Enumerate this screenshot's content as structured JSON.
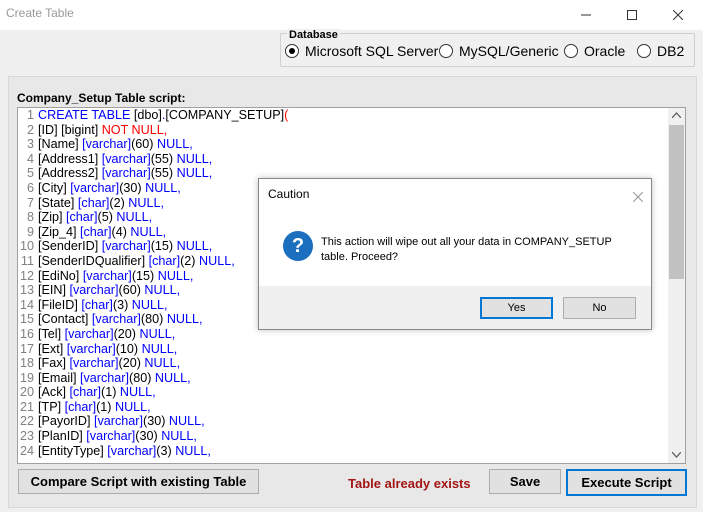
{
  "window": {
    "title": "Create Table"
  },
  "database": {
    "legend": "Database",
    "options": [
      "Microsoft SQL Server",
      "MySQL/Generic",
      "Oracle",
      "DB2"
    ],
    "selected": "Microsoft SQL Server"
  },
  "script": {
    "label": "Company_Setup Table script:",
    "lines": [
      [
        [
          "kw",
          "CREATE TABLE "
        ],
        [
          "tx",
          "[dbo]"
        ],
        [
          "kw",
          "."
        ],
        [
          "tx",
          "[COMPANY_SETUP]"
        ],
        [
          "id",
          "("
        ]
      ],
      [
        [
          "tx",
          "[ID] "
        ],
        [
          "tx",
          "[bigint] "
        ],
        [
          "id",
          "NOT NULL,"
        ]
      ],
      [
        [
          "tx",
          "[Name] "
        ],
        [
          "kw",
          "[varchar]"
        ],
        [
          "tx",
          "(60) "
        ],
        [
          "kw",
          "NULL,"
        ]
      ],
      [
        [
          "tx",
          "[Address1] "
        ],
        [
          "kw",
          "[varchar]"
        ],
        [
          "tx",
          "(55) "
        ],
        [
          "kw",
          "NULL,"
        ]
      ],
      [
        [
          "tx",
          "[Address2] "
        ],
        [
          "kw",
          "[varchar]"
        ],
        [
          "tx",
          "(55) "
        ],
        [
          "kw",
          "NULL,"
        ]
      ],
      [
        [
          "tx",
          "[City] "
        ],
        [
          "kw",
          "[varchar]"
        ],
        [
          "tx",
          "(30) "
        ],
        [
          "kw",
          "NULL,"
        ]
      ],
      [
        [
          "tx",
          "[State] "
        ],
        [
          "kw",
          "[char]"
        ],
        [
          "tx",
          "(2) "
        ],
        [
          "kw",
          "NULL,"
        ]
      ],
      [
        [
          "tx",
          "[Zip] "
        ],
        [
          "kw",
          "[char]"
        ],
        [
          "tx",
          "(5) "
        ],
        [
          "kw",
          "NULL,"
        ]
      ],
      [
        [
          "tx",
          "[Zip_4] "
        ],
        [
          "kw",
          "[char]"
        ],
        [
          "tx",
          "(4) "
        ],
        [
          "kw",
          "NULL,"
        ]
      ],
      [
        [
          "tx",
          "[SenderID] "
        ],
        [
          "kw",
          "[varchar]"
        ],
        [
          "tx",
          "(15) "
        ],
        [
          "kw",
          "NULL,"
        ]
      ],
      [
        [
          "tx",
          "[SenderIDQualifier] "
        ],
        [
          "kw",
          "[char]"
        ],
        [
          "tx",
          "(2) "
        ],
        [
          "kw",
          "NULL,"
        ]
      ],
      [
        [
          "tx",
          "[EdiNo] "
        ],
        [
          "kw",
          "[varchar]"
        ],
        [
          "tx",
          "(15) "
        ],
        [
          "kw",
          "NULL,"
        ]
      ],
      [
        [
          "tx",
          "[EIN] "
        ],
        [
          "kw",
          "[varchar]"
        ],
        [
          "tx",
          "(60) "
        ],
        [
          "kw",
          "NULL,"
        ]
      ],
      [
        [
          "tx",
          "[FileID] "
        ],
        [
          "kw",
          "[char]"
        ],
        [
          "tx",
          "(3) "
        ],
        [
          "kw",
          "NULL,"
        ]
      ],
      [
        [
          "tx",
          "[Contact] "
        ],
        [
          "kw",
          "[varchar]"
        ],
        [
          "tx",
          "(80) "
        ],
        [
          "kw",
          "NULL,"
        ]
      ],
      [
        [
          "tx",
          "[Tel] "
        ],
        [
          "kw",
          "[varchar]"
        ],
        [
          "tx",
          "(20) "
        ],
        [
          "kw",
          "NULL,"
        ]
      ],
      [
        [
          "tx",
          "[Ext] "
        ],
        [
          "kw",
          "[varchar]"
        ],
        [
          "tx",
          "(10) "
        ],
        [
          "kw",
          "NULL,"
        ]
      ],
      [
        [
          "tx",
          "[Fax] "
        ],
        [
          "kw",
          "[varchar]"
        ],
        [
          "tx",
          "(20) "
        ],
        [
          "kw",
          "NULL,"
        ]
      ],
      [
        [
          "tx",
          "[Email] "
        ],
        [
          "kw",
          "[varchar]"
        ],
        [
          "tx",
          "(80) "
        ],
        [
          "kw",
          "NULL,"
        ]
      ],
      [
        [
          "tx",
          "[Ack] "
        ],
        [
          "kw",
          "[char]"
        ],
        [
          "tx",
          "(1) "
        ],
        [
          "kw",
          "NULL,"
        ]
      ],
      [
        [
          "tx",
          "[TP] "
        ],
        [
          "kw",
          "[char]"
        ],
        [
          "tx",
          "(1) "
        ],
        [
          "kw",
          "NULL,"
        ]
      ],
      [
        [
          "tx",
          "[PayorID] "
        ],
        [
          "kw",
          "[varchar]"
        ],
        [
          "tx",
          "(30) "
        ],
        [
          "kw",
          "NULL,"
        ]
      ],
      [
        [
          "tx",
          "[PlanID] "
        ],
        [
          "kw",
          "[varchar]"
        ],
        [
          "tx",
          "(30) "
        ],
        [
          "kw",
          "NULL,"
        ]
      ],
      [
        [
          "tx",
          "[EntityType] "
        ],
        [
          "kw",
          "[varchar]"
        ],
        [
          "tx",
          "(3) "
        ],
        [
          "kw",
          "NULL,"
        ]
      ]
    ]
  },
  "buttons": {
    "compare": "Compare Script with existing Table",
    "save": "Save",
    "execute": "Execute Script"
  },
  "status": {
    "text": "Table already exists",
    "color": "#a31515"
  },
  "dialog": {
    "title": "Caution",
    "message": "This action will wipe out all your data in COMPANY_SETUP table. Proceed?",
    "yes": "Yes",
    "no": "No"
  },
  "colors": {
    "keyword": "#0000ff",
    "identifier": "#ff0000",
    "accent": "#0078d7"
  }
}
